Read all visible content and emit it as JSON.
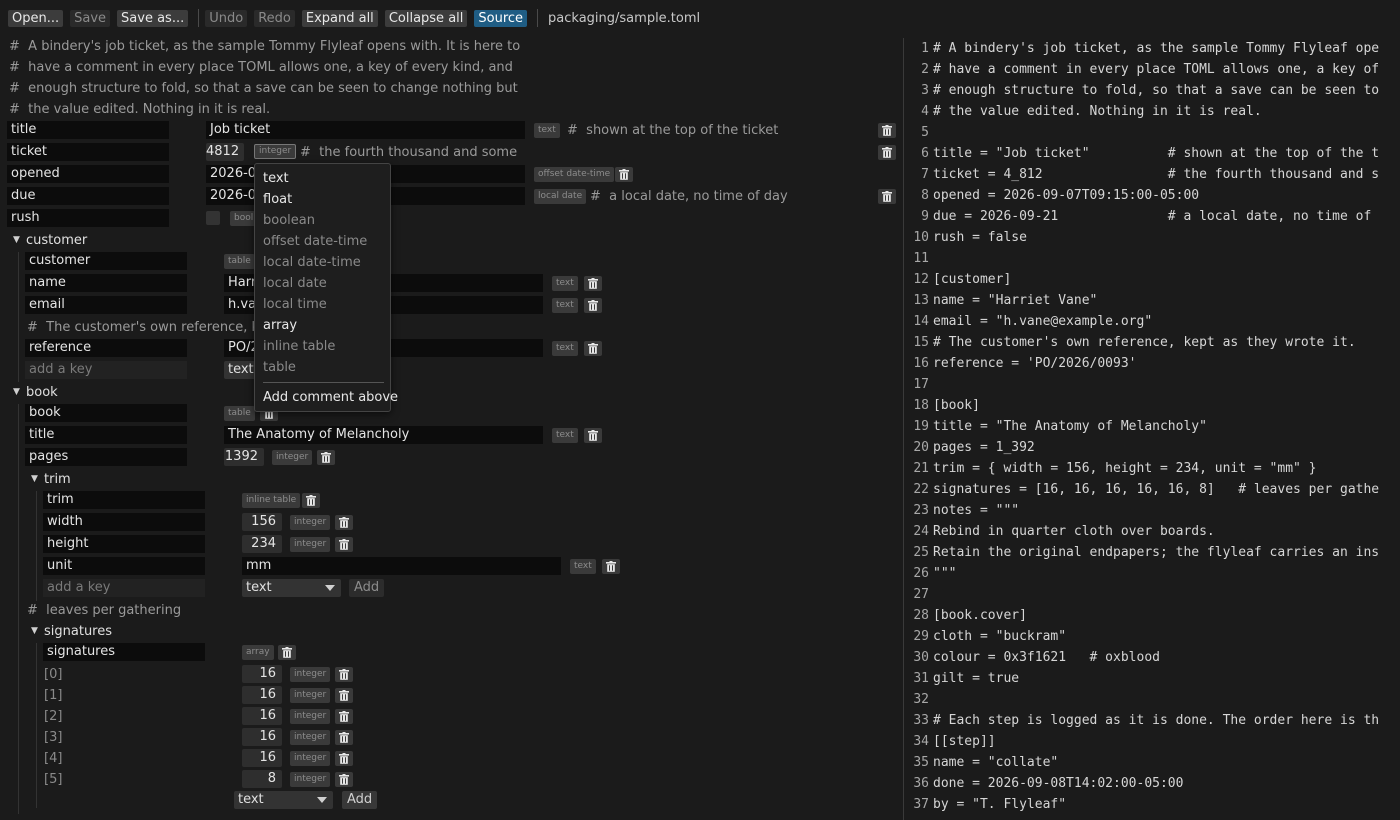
{
  "toolbar": {
    "open": "Open...",
    "save": "Save",
    "save_as": "Save as...",
    "undo": "Undo",
    "redo": "Redo",
    "expand_all": "Expand all",
    "collapse_all": "Collapse all",
    "source": "Source",
    "path": "packaging/sample.toml"
  },
  "editor": {
    "header_comments": [
      "A bindery's job ticket, as the sample Tommy Flyleaf opens with. It is here to",
      "have a comment in every place TOML allows one, a key of every kind, and",
      "enough structure to fold, so that a save can be seen to change nothing but",
      "the value edited. Nothing in it is real."
    ],
    "title": {
      "key": "title",
      "value": "Job ticket",
      "type": "text",
      "comment": "shown at the top of the ticket"
    },
    "ticket": {
      "key": "ticket",
      "value": "4812",
      "type": "integer",
      "comment": "the fourth thousand and some"
    },
    "opened": {
      "key": "opened",
      "value": "2026-09",
      "type": "offset date-time"
    },
    "due": {
      "key": "due",
      "value": "2026-09",
      "type": "local date",
      "comment": "a local date, no time of day"
    },
    "rush": {
      "key": "rush",
      "type": "bool"
    },
    "customer": {
      "section": "customer",
      "row": {
        "key": "customer",
        "type": "table"
      },
      "name": {
        "key": "name",
        "value": "Harr",
        "type": "text"
      },
      "email": {
        "key": "email",
        "value": "h.van",
        "type": "text"
      },
      "comment": "The customer's own reference, kept",
      "reference": {
        "key": "reference",
        "value": "PO/2",
        "type": "text"
      },
      "add_placeholder": "add a key",
      "add_type": "text"
    },
    "book": {
      "section": "book",
      "row": {
        "key": "book",
        "type": "table"
      },
      "title": {
        "key": "title",
        "value": "The Anatomy of Melancholy",
        "type": "text"
      },
      "pages": {
        "key": "pages",
        "value": "1392",
        "type": "integer"
      },
      "trim": {
        "section": "trim",
        "row": {
          "key": "trim",
          "type": "inline table"
        },
        "width": {
          "key": "width",
          "value": "156",
          "type": "integer"
        },
        "height": {
          "key": "height",
          "value": "234",
          "type": "integer"
        },
        "unit": {
          "key": "unit",
          "value": "mm",
          "type": "text"
        },
        "add_placeholder": "add a key",
        "add_type": "text",
        "add_button": "Add"
      },
      "signatures_comment": "leaves per gathering",
      "signatures": {
        "section": "signatures",
        "row": {
          "key": "signatures",
          "type": "array"
        },
        "items": [
          {
            "index": "[0]",
            "value": "16",
            "type": "integer"
          },
          {
            "index": "[1]",
            "value": "16",
            "type": "integer"
          },
          {
            "index": "[2]",
            "value": "16",
            "type": "integer"
          },
          {
            "index": "[3]",
            "value": "16",
            "type": "integer"
          },
          {
            "index": "[4]",
            "value": "16",
            "type": "integer"
          },
          {
            "index": "[5]",
            "value": "8",
            "type": "integer"
          }
        ],
        "add_type": "text",
        "add_button": "Add"
      }
    }
  },
  "menu": {
    "items": [
      {
        "label": "text",
        "enabled": true
      },
      {
        "label": "float",
        "enabled": true
      },
      {
        "label": "boolean",
        "enabled": false
      },
      {
        "label": "offset date-time",
        "enabled": false
      },
      {
        "label": "local date-time",
        "enabled": false
      },
      {
        "label": "local date",
        "enabled": false
      },
      {
        "label": "local time",
        "enabled": false
      },
      {
        "label": "array",
        "enabled": true
      },
      {
        "label": "inline table",
        "enabled": false
      },
      {
        "label": "table",
        "enabled": false
      }
    ],
    "comment_item": "Add comment above"
  },
  "source": {
    "lines": [
      {
        "n": "1",
        "text": "# A bindery's job ticket, as the sample Tommy Flyleaf ope"
      },
      {
        "n": "2",
        "text": "# have a comment in every place TOML allows one, a key of"
      },
      {
        "n": "3",
        "text": "# enough structure to fold, so that a save can be seen to"
      },
      {
        "n": "4",
        "text": "# the value edited. Nothing in it is real."
      },
      {
        "n": "5",
        "text": ""
      },
      {
        "n": "6",
        "text": "title = \"Job ticket\"          # shown at the top of the t"
      },
      {
        "n": "7",
        "text": "ticket = 4_812                # the fourth thousand and s"
      },
      {
        "n": "8",
        "text": "opened = 2026-09-07T09:15:00-05:00"
      },
      {
        "n": "9",
        "text": "due = 2026-09-21              # a local date, no time of"
      },
      {
        "n": "10",
        "text": "rush = false"
      },
      {
        "n": "11",
        "text": ""
      },
      {
        "n": "12",
        "text": "[customer]"
      },
      {
        "n": "13",
        "text": "name = \"Harriet Vane\""
      },
      {
        "n": "14",
        "text": "email = \"h.vane@example.org\""
      },
      {
        "n": "15",
        "text": "# The customer's own reference, kept as they wrote it."
      },
      {
        "n": "16",
        "text": "reference = 'PO/2026/0093'"
      },
      {
        "n": "17",
        "text": ""
      },
      {
        "n": "18",
        "text": "[book]"
      },
      {
        "n": "19",
        "text": "title = \"The Anatomy of Melancholy\""
      },
      {
        "n": "20",
        "text": "pages = 1_392"
      },
      {
        "n": "21",
        "text": "trim = { width = 156, height = 234, unit = \"mm\" }"
      },
      {
        "n": "22",
        "text": "signatures = [16, 16, 16, 16, 16, 8]   # leaves per gathe"
      },
      {
        "n": "23",
        "text": "notes = \"\"\""
      },
      {
        "n": "24",
        "text": "Rebind in quarter cloth over boards."
      },
      {
        "n": "25",
        "text": "Retain the original endpapers; the flyleaf carries an ins"
      },
      {
        "n": "26",
        "text": "\"\"\""
      },
      {
        "n": "27",
        "text": ""
      },
      {
        "n": "28",
        "text": "[book.cover]"
      },
      {
        "n": "29",
        "text": "cloth = \"buckram\""
      },
      {
        "n": "30",
        "text": "colour = 0x3f1621   # oxblood"
      },
      {
        "n": "31",
        "text": "gilt = true"
      },
      {
        "n": "32",
        "text": ""
      },
      {
        "n": "33",
        "text": "# Each step is logged as it is done. The order here is th"
      },
      {
        "n": "34",
        "text": "[[step]]"
      },
      {
        "n": "35",
        "text": "name = \"collate\""
      },
      {
        "n": "36",
        "text": "done = 2026-09-08T14:02:00-05:00"
      },
      {
        "n": "37",
        "text": "by = \"T. Flyleaf\""
      }
    ]
  }
}
